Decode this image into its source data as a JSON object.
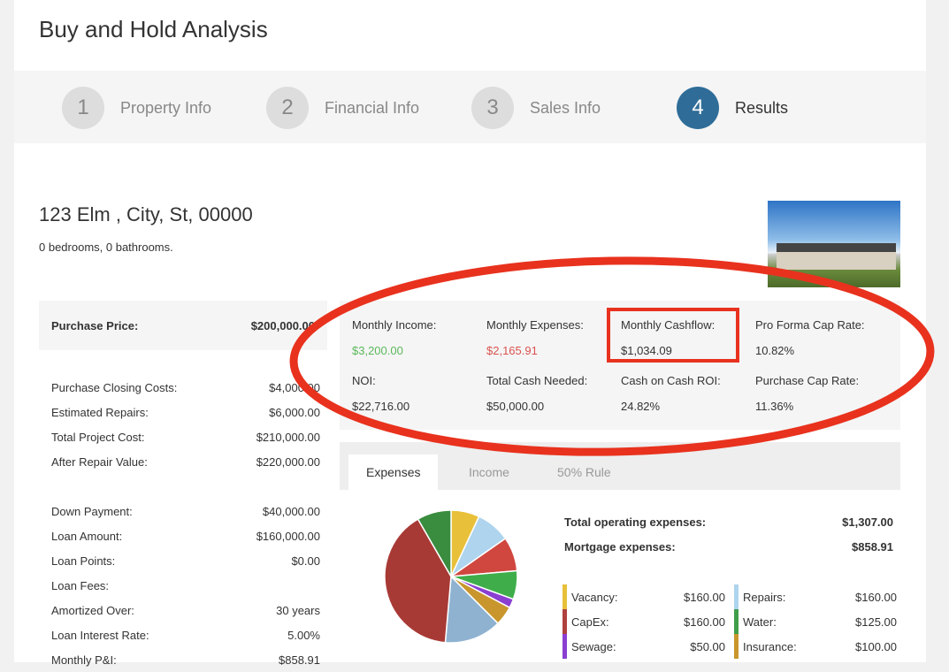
{
  "title": "Buy and Hold Analysis",
  "steps": [
    {
      "num": "1",
      "label": "Property Info"
    },
    {
      "num": "2",
      "label": "Financial Info"
    },
    {
      "num": "3",
      "label": "Sales Info"
    },
    {
      "num": "4",
      "label": "Results",
      "active": true
    }
  ],
  "property": {
    "address": "123 Elm , City, St, 00000",
    "details": "0 bedrooms, 0 bathrooms."
  },
  "purchase": {
    "label": "Purchase Price:",
    "value": "$200,000.00"
  },
  "groups": [
    [
      {
        "label": "Purchase Closing Costs:",
        "value": "$4,000.00"
      },
      {
        "label": "Estimated Repairs:",
        "value": "$6,000.00"
      },
      {
        "label": "Total Project Cost:",
        "value": "$210,000.00"
      },
      {
        "label": "After Repair Value:",
        "value": "$220,000.00"
      }
    ],
    [
      {
        "label": "Down Payment:",
        "value": "$40,000.00"
      },
      {
        "label": "Loan Amount:",
        "value": "$160,000.00"
      },
      {
        "label": "Loan Points:",
        "value": "$0.00"
      },
      {
        "label": "Loan Fees:",
        "value": ""
      },
      {
        "label": "Amortized Over:",
        "value": "30 years"
      },
      {
        "label": "Loan Interest Rate:",
        "value": "5.00%"
      },
      {
        "label": "Monthly P&I:",
        "value": "$858.91"
      }
    ]
  ],
  "metrics": [
    {
      "label": "Monthly Income:",
      "value": "$3,200.00",
      "color": "#5cb85c"
    },
    {
      "label": "Monthly Expenses:",
      "value": "$2,165.91",
      "color": "#d9534f"
    },
    {
      "label": "Monthly Cashflow:",
      "value": "$1,034.09"
    },
    {
      "label": "Pro Forma Cap Rate:",
      "value": "10.82%"
    },
    {
      "label": "NOI:",
      "value": "$22,716.00"
    },
    {
      "label": "Total Cash Needed:",
      "value": "$50,000.00"
    },
    {
      "label": "Cash on Cash ROI:",
      "value": "24.82%"
    },
    {
      "label": "Purchase Cap Rate:",
      "value": "11.36%"
    }
  ],
  "tabs": [
    {
      "label": "Expenses",
      "active": true
    },
    {
      "label": "Income"
    },
    {
      "label": "50% Rule"
    }
  ],
  "totals": [
    {
      "label": "Total operating expenses:",
      "value": "$1,307.00"
    },
    {
      "label": "Mortgage expenses:",
      "value": "$858.91"
    }
  ],
  "legend": [
    {
      "label": "Vacancy:",
      "value": "$160.00",
      "color": "#e8c03a"
    },
    {
      "label": "Repairs:",
      "value": "$160.00",
      "color": "#aed4ee"
    },
    {
      "label": "CapEx:",
      "value": "$160.00",
      "color": "#b0413e"
    },
    {
      "label": "Water:",
      "value": "$125.00",
      "color": "#3f9e4a"
    },
    {
      "label": "Sewage:",
      "value": "$50.00",
      "color": "#8a3fd1"
    },
    {
      "label": "Insurance:",
      "value": "$100.00",
      "color": "#c8962c"
    }
  ],
  "pie": [
    {
      "value": 25,
      "color": "#e8c03a"
    },
    {
      "value": 30,
      "color": "#aed4ee"
    },
    {
      "value": 30,
      "color": "#d0473f"
    },
    {
      "value": 25,
      "color": "#3fae4a"
    },
    {
      "value": 8,
      "color": "#8a3fd1"
    },
    {
      "value": 17,
      "color": "#c8962c"
    },
    {
      "value": 50,
      "color": "#8fb2d1"
    },
    {
      "value": 145,
      "color": "#a83a36"
    },
    {
      "value": 30,
      "color": "#3a8c3e"
    }
  ],
  "annotation_color": "#e8321e"
}
